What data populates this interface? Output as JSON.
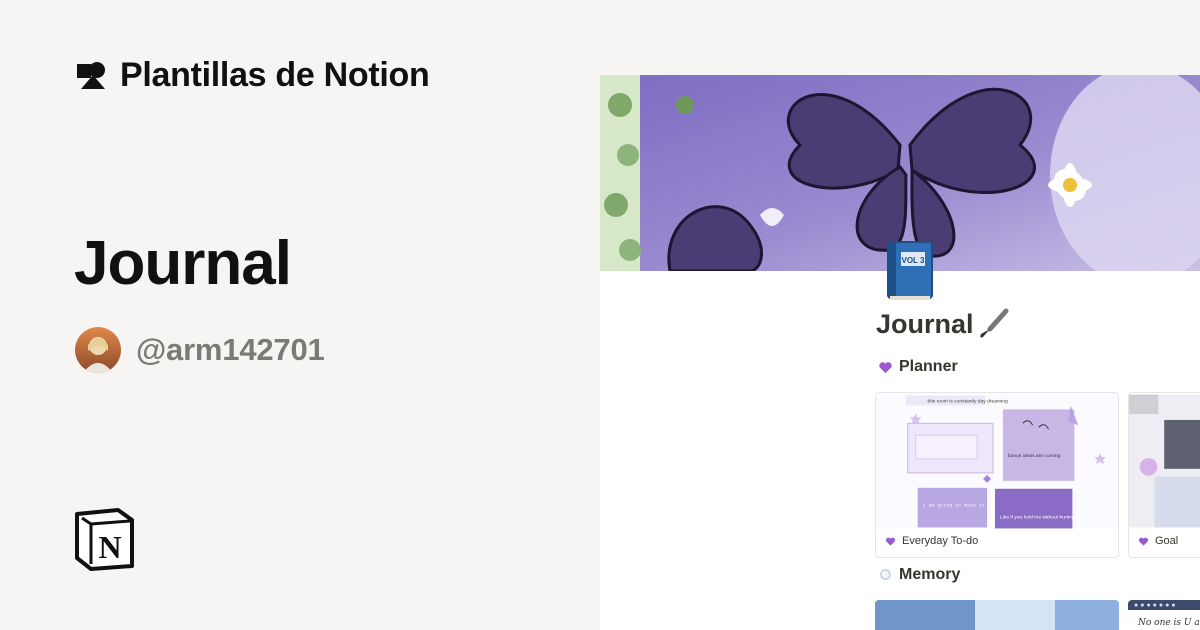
{
  "brand": {
    "name": "Plantillas de Notion",
    "icon": "notion-shapes-icon"
  },
  "template": {
    "title": "Journal"
  },
  "author": {
    "handle": "@arm142701",
    "avatar": "author-avatar"
  },
  "footer": {
    "logo": "notion-logo"
  },
  "preview": {
    "page_icon": "blue-book-icon",
    "title": "Journal",
    "title_icon": "paintbrush-icon",
    "sections": [
      {
        "label": "Planner",
        "emoji": "purple-heart-icon",
        "cards": [
          {
            "label": "Everyday To-do",
            "emoji": "purple-heart-icon",
            "thumb_text": [
              "this room is constantly day dreaming",
              "bonus ideas are coming",
              "i am going to make it so proud",
              "Like if you hold me without hurting me"
            ]
          },
          {
            "label": "Goal",
            "emoji": "purple-heart-icon"
          }
        ]
      },
      {
        "label": "Memory",
        "emoji": "bubble-icon",
        "cards": [
          {
            "label": ""
          },
          {
            "label": "",
            "thumb_text": "No one is U and"
          }
        ]
      }
    ]
  },
  "colors": {
    "background": "#f6f5f4",
    "text": "#111111",
    "muted": "#7d7a75",
    "accent_purple": "#8e7bc4"
  }
}
